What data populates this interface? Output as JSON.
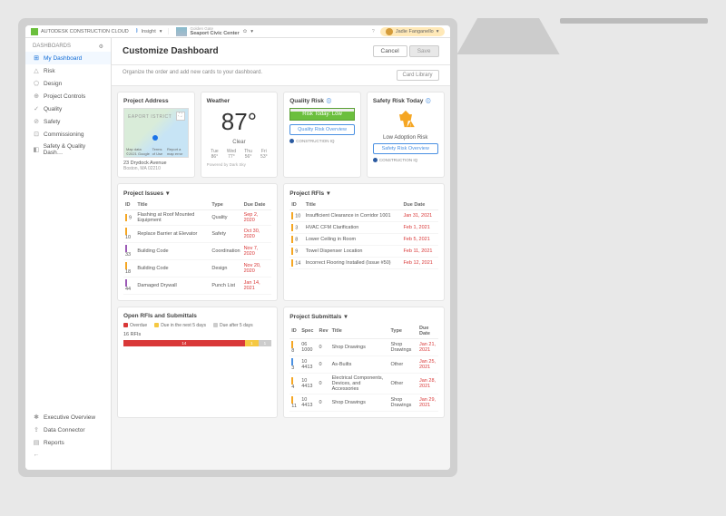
{
  "topbar": {
    "brand": "AUTODESK CONSTRUCTION CLOUD",
    "insight_label": "Insight",
    "org": "Golden Gate",
    "project": "Seaport Civic Center",
    "user": "Jadie Fanganello"
  },
  "sidebar": {
    "header": "DASHBOARDS",
    "items": [
      {
        "label": "My Dashboard",
        "icon": "⊞"
      },
      {
        "label": "Risk",
        "icon": "△"
      },
      {
        "label": "Design",
        "icon": "⬠"
      },
      {
        "label": "Project Controls",
        "icon": "⊕"
      },
      {
        "label": "Quality",
        "icon": "✓"
      },
      {
        "label": "Safety",
        "icon": "⊘"
      },
      {
        "label": "Commissioning",
        "icon": "⊡"
      },
      {
        "label": "Safety & Quality Dash…",
        "icon": "◧"
      }
    ],
    "bottom": [
      {
        "label": "Executive Overview",
        "icon": "✱"
      },
      {
        "label": "Data Connector",
        "icon": "⇪"
      },
      {
        "label": "Reports",
        "icon": "▤"
      },
      {
        "label": "",
        "icon": "←"
      }
    ]
  },
  "main": {
    "title": "Customize Dashboard",
    "cancel": "Cancel",
    "save": "Save",
    "hint": "Organize the order and add new cards to your dashboard.",
    "card_library": "Card Library"
  },
  "cards": {
    "address": {
      "title": "Project Address",
      "map_label": "EAPORT ISTRICT",
      "attribution": "Map data ©2021 Google",
      "terms": "Terms of Use",
      "report": "Report a map error",
      "line1": "23 Drydock Avenue",
      "line2": "Boston, MA 02210"
    },
    "weather": {
      "title": "Weather",
      "temp": "87°",
      "cond": "Clear",
      "forecast": [
        {
          "d": "Tue",
          "t": "86°"
        },
        {
          "d": "Wed",
          "t": "77°"
        },
        {
          "d": "Thu",
          "t": "56°"
        },
        {
          "d": "Fri",
          "t": "53°"
        }
      ],
      "powered": "Powered by Dark Sky"
    },
    "quality_risk": {
      "title": "Quality Risk",
      "risk_label": "Risk Today: Low",
      "btn": "Quality Risk Overview",
      "footer": "CONSTRUCTION IQ"
    },
    "safety_risk": {
      "title": "Safety Risk Today",
      "label": "Low Adoption Risk",
      "btn": "Safety Risk Overview",
      "footer": "CONSTRUCTION IQ"
    },
    "issues": {
      "title": "Project Issues",
      "cols": {
        "id": "ID",
        "title": "Title",
        "type": "Type",
        "due": "Due Date"
      },
      "rows": [
        {
          "id": "9",
          "t": "Flashing at Roof Mounted Equipment",
          "ty": "Quality",
          "d": "Sep 2, 2020",
          "s": "s-orange"
        },
        {
          "id": "10",
          "t": "Replace Barrier at Elevator",
          "ty": "Safety",
          "d": "Oct 30, 2020",
          "s": "s-orange"
        },
        {
          "id": "33",
          "t": "Building Code",
          "ty": "Coordination",
          "d": "Nov 7, 2020",
          "s": "s-purple"
        },
        {
          "id": "18",
          "t": "Building Code",
          "ty": "Design",
          "d": "Nov 20, 2020",
          "s": "s-orange"
        },
        {
          "id": "44",
          "t": "Damaged Drywall",
          "ty": "Punch List",
          "d": "Jan 14, 2021",
          "s": "s-purple"
        }
      ]
    },
    "rfis": {
      "title": "Project RFIs",
      "cols": {
        "id": "ID",
        "title": "Title",
        "due": "Due Date"
      },
      "rows": [
        {
          "id": "10",
          "t": "Insufficient Clearance in Corridor 1001",
          "d": "Jan 31, 2021",
          "s": "s-orange"
        },
        {
          "id": "3",
          "t": "HVAC CFM Clarification",
          "d": "Feb 1, 2021",
          "s": "s-orange"
        },
        {
          "id": "8",
          "t": "Lower Ceiling in Room",
          "d": "Feb 5, 2021",
          "s": "s-orange"
        },
        {
          "id": "9",
          "t": "Towel Dispenser Location",
          "d": "Feb 11, 2021",
          "s": "s-orange"
        },
        {
          "id": "14",
          "t": "Incorrect Flooring Installed (Issue #50)",
          "d": "Feb 12, 2021",
          "s": "s-orange"
        }
      ]
    },
    "open_rfis": {
      "title": "Open RFIs and Submittals",
      "legend": [
        {
          "l": "Overdue",
          "c": "d-red"
        },
        {
          "l": "Due in the next 5 days",
          "c": "d-yellow"
        },
        {
          "l": "Due after 5 days",
          "c": "d-grey"
        }
      ],
      "count_label": "16 RFIs",
      "segments": [
        {
          "v": "14",
          "c": "#d93838",
          "w": "82%"
        },
        {
          "v": "1",
          "c": "#f5c842",
          "w": "9%"
        },
        {
          "v": "1",
          "c": "#ccc",
          "w": "9%"
        }
      ]
    },
    "submittals": {
      "title": "Project Submittals",
      "cols": {
        "id": "ID",
        "spec": "Spec",
        "rev": "Rev",
        "title": "Title",
        "type": "Type",
        "due": "Due Date"
      },
      "rows": [
        {
          "id": "8",
          "sp": "06 1000",
          "r": "0",
          "t": "Shop Drawings",
          "ty": "Shop Drawings",
          "d": "Jan 21, 2021",
          "s": "s-orange"
        },
        {
          "id": "3",
          "sp": "10 4413",
          "r": "0",
          "t": "As-Builts",
          "ty": "Other",
          "d": "Jan 25, 2021",
          "s": "s-blue"
        },
        {
          "id": "4",
          "sp": "10 4413",
          "r": "0",
          "t": "Electrical Components, Devices, and Accessories",
          "ty": "Other",
          "d": "Jan 28, 2021",
          "s": "s-orange"
        },
        {
          "id": "11",
          "sp": "10 4413",
          "r": "0",
          "t": "Shop Drawings",
          "ty": "Shop Drawings",
          "d": "Jan 29, 2021",
          "s": "s-orange"
        }
      ]
    }
  }
}
